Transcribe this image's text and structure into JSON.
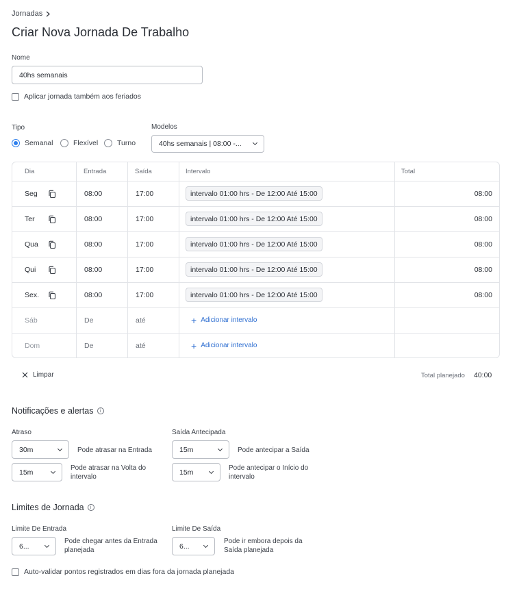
{
  "breadcrumb": {
    "label": "Jornadas"
  },
  "page_title": "Criar Nova Jornada De Trabalho",
  "name_field": {
    "label": "Nome",
    "value": "40hs semanais"
  },
  "holidays_checkbox": {
    "label": "Aplicar jornada também aos feriados",
    "checked": false
  },
  "type": {
    "label": "Tipo",
    "options": [
      {
        "label": "Semanal",
        "selected": true
      },
      {
        "label": "Flexível",
        "selected": false
      },
      {
        "label": "Turno",
        "selected": false
      }
    ]
  },
  "models": {
    "label": "Modelos",
    "selected": "40hs semanais | 08:00 -..."
  },
  "table": {
    "headers": {
      "day": "Dia",
      "entry": "Entrada",
      "exit": "Saída",
      "interval": "Intervalo",
      "total": "Total"
    },
    "rows": [
      {
        "day": "Seg",
        "entry": "08:00",
        "exit": "17:00",
        "interval": "intervalo 01:00 hrs - De 12:00 Até 15:00",
        "total": "08:00"
      },
      {
        "day": "Ter",
        "entry": "08:00",
        "exit": "17:00",
        "interval": "intervalo 01:00 hrs - De 12:00 Até 15:00",
        "total": "08:00"
      },
      {
        "day": "Qua",
        "entry": "08:00",
        "exit": "17:00",
        "interval": "intervalo 01:00 hrs - De 12:00 Até 15:00",
        "total": "08:00"
      },
      {
        "day": "Qui",
        "entry": "08:00",
        "exit": "17:00",
        "interval": "intervalo 01:00 hrs - De 12:00 Até 15:00",
        "total": "08:00"
      },
      {
        "day": "Sex.",
        "entry": "08:00",
        "exit": "17:00",
        "interval": "intervalo 01:00 hrs - De 12:00 Até 15:00",
        "total": "08:00"
      }
    ],
    "empty_rows": [
      {
        "day": "Sáb",
        "entry": "De",
        "exit": "até",
        "add_label": "Adicionar intervalo"
      },
      {
        "day": "Dom",
        "entry": "De",
        "exit": "até",
        "add_label": "Adicionar intervalo"
      }
    ]
  },
  "clear_button": {
    "label": "Limpar"
  },
  "total_planned": {
    "label": "Total planejado",
    "value": "40:00"
  },
  "notifications": {
    "title": "Notificações e alertas",
    "delay": {
      "label": "Atraso",
      "entry": {
        "value": "30m",
        "description": "Pode atrasar na Entrada"
      },
      "return": {
        "value": "15m",
        "description": "Pode atrasar na Volta do intervalo"
      }
    },
    "early_exit": {
      "label": "Saída Antecipada",
      "exit": {
        "value": "15m",
        "description": "Pode antecipar a Saída"
      },
      "interval": {
        "value": "15m",
        "description": "Pode antecipar o Início do intervalo"
      }
    }
  },
  "limits": {
    "title": "Limites de Jornada",
    "entry_limit": {
      "label": "Limite De Entrada",
      "value": "6...",
      "description": "Pode chegar antes da Entrada planejada"
    },
    "exit_limit": {
      "label": "Limite De Saída",
      "value": "6...",
      "description": "Pode ir embora depois da Saída planejada"
    }
  },
  "auto_validate": {
    "label": "Auto-validar pontos registrados em dias fora da jornada planejada",
    "checked": false
  },
  "colors": {
    "accent": "#2f80ed",
    "link": "#2f6fd1",
    "border": "#e2e4e8"
  },
  "icons": {
    "copy": "copy-icon",
    "breadcrumb_separator": "chevron-right-icon",
    "clear": "close-icon",
    "add": "plus-icon",
    "info": "info-icon",
    "dropdown": "chevron-down-icon"
  }
}
